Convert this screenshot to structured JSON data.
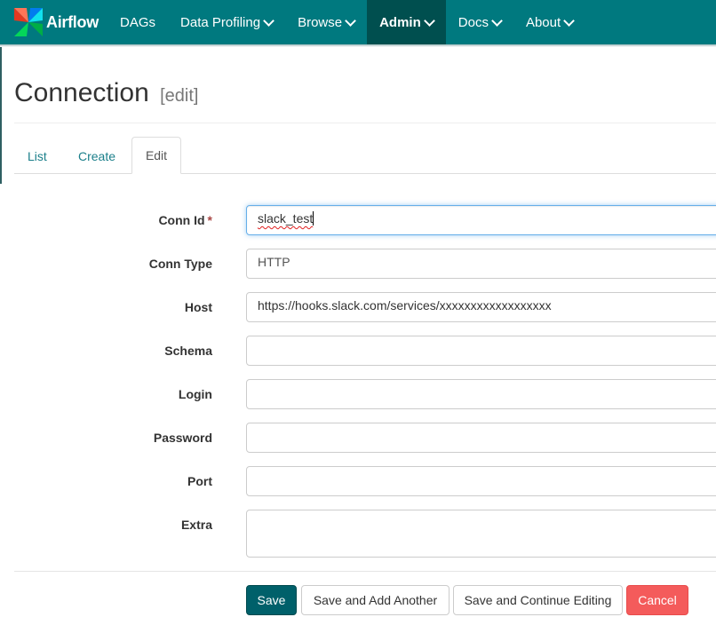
{
  "app": {
    "brand_name": "Airflow",
    "brand_icon": "airflow-pinwheel-icon"
  },
  "navbar": {
    "items": [
      {
        "label": "DAGs",
        "has_dropdown": false,
        "active": false
      },
      {
        "label": "Data Profiling",
        "has_dropdown": true,
        "active": false
      },
      {
        "label": "Browse",
        "has_dropdown": true,
        "active": false
      },
      {
        "label": "Admin",
        "has_dropdown": true,
        "active": true
      },
      {
        "label": "Docs",
        "has_dropdown": true,
        "active": false
      },
      {
        "label": "About",
        "has_dropdown": true,
        "active": false
      }
    ]
  },
  "page": {
    "title": "Connection",
    "subtitle": "[edit]"
  },
  "tabs": [
    {
      "label": "List",
      "active": false
    },
    {
      "label": "Create",
      "active": false
    },
    {
      "label": "Edit",
      "active": true
    }
  ],
  "form": {
    "conn_id": {
      "label": "Conn Id",
      "required_marker": "*",
      "value": "slack_test"
    },
    "conn_type": {
      "label": "Conn Type",
      "value": "HTTP"
    },
    "host": {
      "label": "Host",
      "value": "https://hooks.slack.com/services/xxxxxxxxxxxxxxxxxx"
    },
    "schema": {
      "label": "Schema",
      "value": ""
    },
    "login": {
      "label": "Login",
      "value": ""
    },
    "password": {
      "label": "Password",
      "value": ""
    },
    "port": {
      "label": "Port",
      "value": ""
    },
    "extra": {
      "label": "Extra",
      "value": ""
    }
  },
  "buttons": {
    "save": "Save",
    "save_add_another": "Save and Add Another",
    "save_continue": "Save and Continue Editing",
    "cancel": "Cancel"
  },
  "colors": {
    "navbar": "#00797f",
    "navbar_active": "#004f4f",
    "primary_button": "#00606a",
    "danger_button": "#f45b5b",
    "link": "#1b7f8a",
    "required": "#a94442"
  }
}
